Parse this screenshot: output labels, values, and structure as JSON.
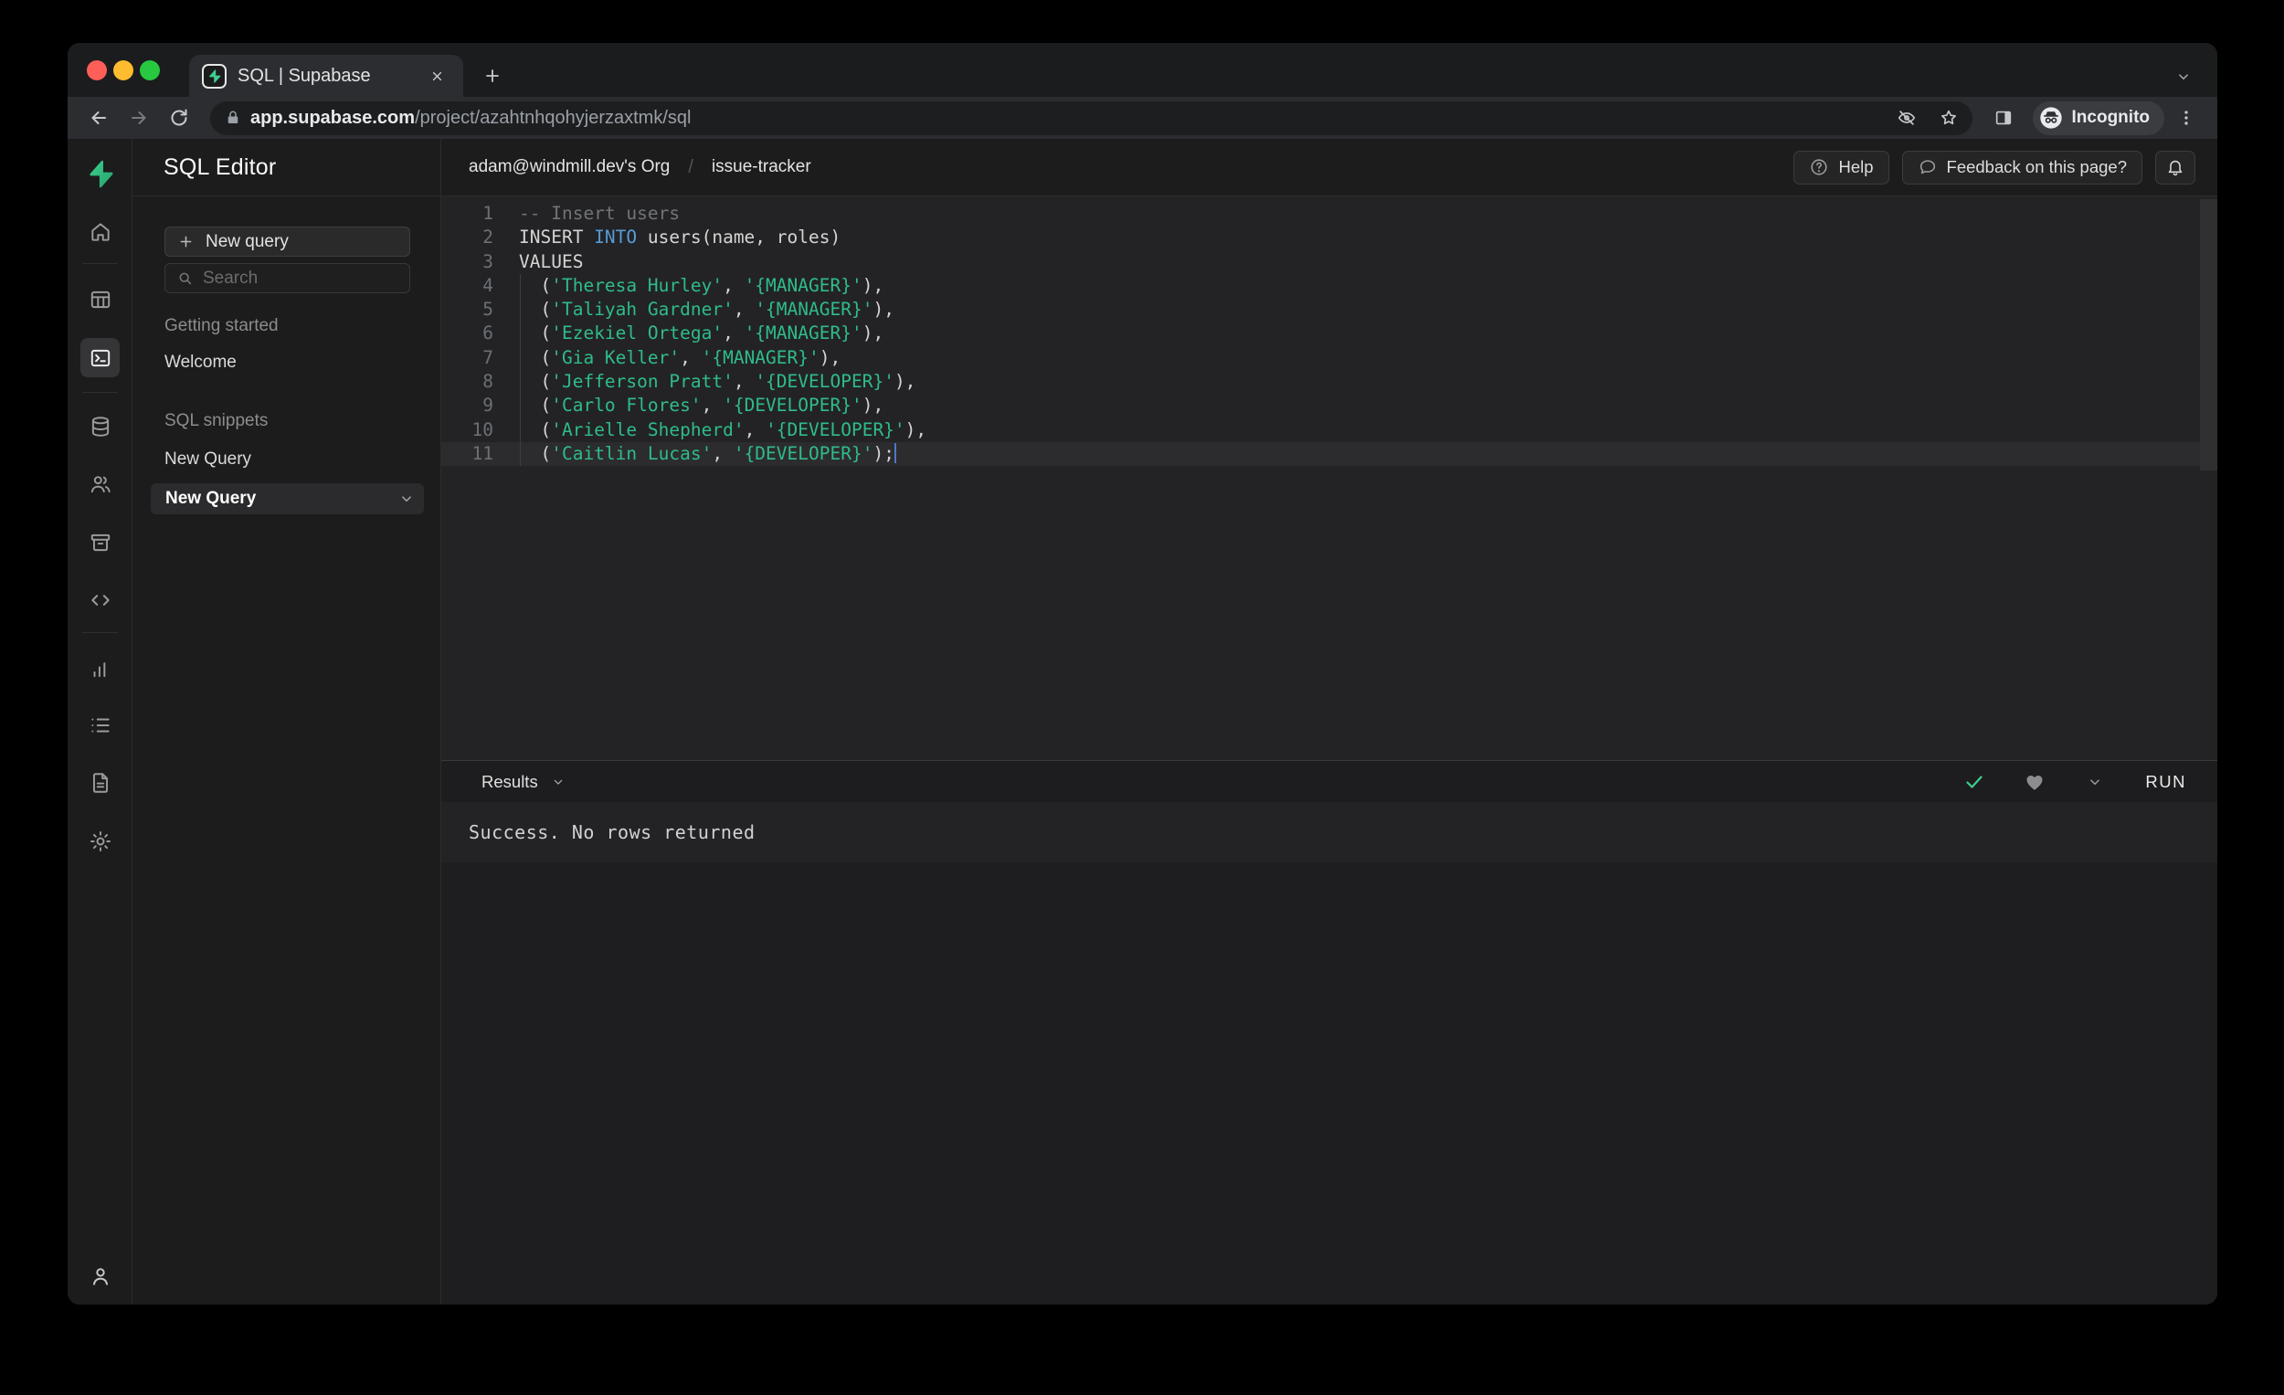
{
  "browser": {
    "tab": {
      "title": "SQL | Supabase",
      "favicon": "supabase-bolt-icon"
    },
    "url": {
      "domain": "app.supabase.com",
      "path": "/project/azahtnhqohyjerzaxtmk/sql"
    },
    "incognito_label": "Incognito"
  },
  "header": {
    "app_title": "SQL Editor",
    "breadcrumb": {
      "org": "adam@windmill.dev's Org",
      "separator": "/",
      "project": "issue-tracker"
    },
    "help_label": "Help",
    "feedback_label": "Feedback on this page?"
  },
  "rail": {
    "items": [
      {
        "name": "home",
        "icon": "home",
        "active": false
      },
      {
        "name": "table-editor",
        "icon": "table",
        "active": false
      },
      {
        "name": "sql-editor",
        "icon": "terminal",
        "active": true
      },
      {
        "name": "database",
        "icon": "database",
        "active": false
      },
      {
        "name": "authentication",
        "icon": "users",
        "active": false
      },
      {
        "name": "storage",
        "icon": "archive",
        "active": false
      },
      {
        "name": "edge-functions",
        "icon": "code",
        "active": false
      },
      {
        "name": "reports",
        "icon": "bar-chart",
        "active": false
      },
      {
        "name": "logs",
        "icon": "list",
        "active": false
      },
      {
        "name": "api-docs",
        "icon": "file-text",
        "active": false
      },
      {
        "name": "settings",
        "icon": "gear",
        "active": false
      }
    ],
    "account": {
      "name": "account",
      "icon": "user"
    }
  },
  "sidebar": {
    "new_query_button": "New query",
    "search_placeholder": "Search",
    "sections": [
      {
        "title": "Getting started",
        "items": [
          {
            "label": "Welcome",
            "active": false
          }
        ]
      },
      {
        "title": "SQL snippets",
        "items": [
          {
            "label": "New Query",
            "active": false
          },
          {
            "label": "New Query",
            "active": true
          }
        ]
      }
    ]
  },
  "editor": {
    "lines": [
      {
        "num": 1,
        "tokens": [
          {
            "t": "-- Insert users",
            "c": "comment"
          }
        ]
      },
      {
        "num": 2,
        "tokens": [
          {
            "t": "INSERT ",
            "c": "plain"
          },
          {
            "t": "INTO",
            "c": "keyword"
          },
          {
            "t": " users(name, roles)",
            "c": "plain"
          }
        ]
      },
      {
        "num": 3,
        "tokens": [
          {
            "t": "VALUES",
            "c": "plain"
          }
        ]
      },
      {
        "num": 4,
        "guide": true,
        "tokens": [
          {
            "t": "  (",
            "c": "plain"
          },
          {
            "t": "'Theresa Hurley'",
            "c": "string"
          },
          {
            "t": ", ",
            "c": "plain"
          },
          {
            "t": "'{MANAGER}'",
            "c": "string"
          },
          {
            "t": "),",
            "c": "plain"
          }
        ]
      },
      {
        "num": 5,
        "guide": true,
        "tokens": [
          {
            "t": "  (",
            "c": "plain"
          },
          {
            "t": "'Taliyah Gardner'",
            "c": "string"
          },
          {
            "t": ", ",
            "c": "plain"
          },
          {
            "t": "'{MANAGER}'",
            "c": "string"
          },
          {
            "t": "),",
            "c": "plain"
          }
        ]
      },
      {
        "num": 6,
        "guide": true,
        "tokens": [
          {
            "t": "  (",
            "c": "plain"
          },
          {
            "t": "'Ezekiel Ortega'",
            "c": "string"
          },
          {
            "t": ", ",
            "c": "plain"
          },
          {
            "t": "'{MANAGER}'",
            "c": "string"
          },
          {
            "t": "),",
            "c": "plain"
          }
        ]
      },
      {
        "num": 7,
        "guide": true,
        "tokens": [
          {
            "t": "  (",
            "c": "plain"
          },
          {
            "t": "'Gia Keller'",
            "c": "string"
          },
          {
            "t": ", ",
            "c": "plain"
          },
          {
            "t": "'{MANAGER}'",
            "c": "string"
          },
          {
            "t": "),",
            "c": "plain"
          }
        ]
      },
      {
        "num": 8,
        "guide": true,
        "tokens": [
          {
            "t": "  (",
            "c": "plain"
          },
          {
            "t": "'Jefferson Pratt'",
            "c": "string"
          },
          {
            "t": ", ",
            "c": "plain"
          },
          {
            "t": "'{DEVELOPER}'",
            "c": "string"
          },
          {
            "t": "),",
            "c": "plain"
          }
        ]
      },
      {
        "num": 9,
        "guide": true,
        "tokens": [
          {
            "t": "  (",
            "c": "plain"
          },
          {
            "t": "'Carlo Flores'",
            "c": "string"
          },
          {
            "t": ", ",
            "c": "plain"
          },
          {
            "t": "'{DEVELOPER}'",
            "c": "string"
          },
          {
            "t": "),",
            "c": "plain"
          }
        ]
      },
      {
        "num": 10,
        "guide": true,
        "tokens": [
          {
            "t": "  (",
            "c": "plain"
          },
          {
            "t": "'Arielle Shepherd'",
            "c": "string"
          },
          {
            "t": ", ",
            "c": "plain"
          },
          {
            "t": "'{DEVELOPER}'",
            "c": "string"
          },
          {
            "t": "),",
            "c": "plain"
          }
        ]
      },
      {
        "num": 11,
        "guide": true,
        "current": true,
        "cursor": true,
        "tokens": [
          {
            "t": "  (",
            "c": "plain"
          },
          {
            "t": "'Caitlin Lucas'",
            "c": "string"
          },
          {
            "t": ", ",
            "c": "plain"
          },
          {
            "t": "'{DEVELOPER}'",
            "c": "string"
          },
          {
            "t": ");",
            "c": "plain"
          }
        ]
      }
    ]
  },
  "results": {
    "label": "Results",
    "run_label": "RUN",
    "message": "Success. No rows returned"
  },
  "colors": {
    "accent_green": "#3ecf8e",
    "keyword_blue": "#569cd6",
    "string_green": "#2fbc8a",
    "success_check_green": "#3ecf8e"
  }
}
